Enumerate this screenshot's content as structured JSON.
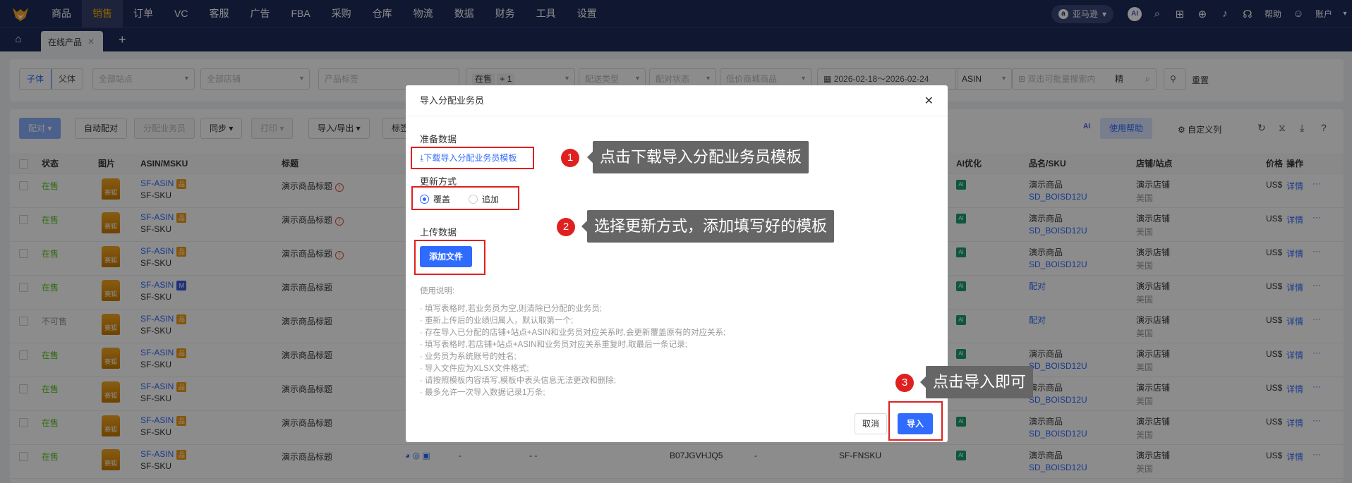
{
  "nav": {
    "items": [
      "商品",
      "销售",
      "订单",
      "VC",
      "客服",
      "广告",
      "FBA",
      "采购",
      "仓库",
      "物流",
      "数据",
      "财务",
      "工具",
      "设置"
    ],
    "active_index": 1,
    "marketplace": "亚马逊",
    "ai_badge": "AI",
    "help": "帮助",
    "account": "账户"
  },
  "tabs": {
    "active": "在线产品"
  },
  "filters": {
    "seg_child": "子体",
    "seg_parent": "父体",
    "site": "全部站点",
    "store": "全部店铺",
    "tag": "产品标签",
    "status_tag": "在售",
    "status_more": "+ 1",
    "ship_type": "配送类型",
    "pair_state": "配对状态",
    "low_price": "低价商城商品",
    "date_range": "2026-02-18～2026-02-24",
    "search_type": "ASIN",
    "search_placeholder": "双击可批量搜索内",
    "precise": "精",
    "reset": "重置"
  },
  "toolbar": {
    "pair": "配对",
    "auto_pair": "自动配对",
    "assign": "分配业务员",
    "sync": "同步",
    "print": "打印",
    "import_export": "导入/导出",
    "tag": "标签",
    "help": "使用帮助",
    "custom_cols": "自定义列"
  },
  "table": {
    "headers": {
      "status": "状态",
      "image": "图片",
      "asin": "ASIN/MSKU",
      "title": "标题",
      "ai": "AI优化",
      "sku": "品名/SKU",
      "store": "店铺/站点",
      "price": "价格",
      "ops": "操作"
    },
    "rows": [
      {
        "status": "在售",
        "asin": "SF-ASIN",
        "msku": "SF-SKU",
        "badge": "品",
        "title": "演示商品标题",
        "warn": true,
        "name": "演示商品",
        "sku": "SD_BOISD12U",
        "store": "演示店铺",
        "site": "美国",
        "price": "US$",
        "detail": "详情"
      },
      {
        "status": "在售",
        "asin": "SF-ASIN",
        "msku": "SF-SKU",
        "badge": "品",
        "title": "演示商品标题",
        "warn": true,
        "name": "演示商品",
        "sku": "SD_BOISD12U",
        "store": "演示店铺",
        "site": "美国",
        "price": "US$",
        "detail": "详情"
      },
      {
        "status": "在售",
        "asin": "SF-ASIN",
        "msku": "SF-SKU",
        "badge": "品",
        "title": "演示商品标题",
        "warn": true,
        "name": "演示商品",
        "sku": "SD_BOISD12U",
        "store": "演示店铺",
        "site": "美国",
        "price": "US$",
        "detail": "详情"
      },
      {
        "status": "在售",
        "asin": "SF-ASIN",
        "msku": "SF-SKU",
        "badge": "M",
        "title": "演示商品标题",
        "warn": false,
        "name": "配对",
        "sku": "",
        "store": "演示店铺",
        "site": "美国",
        "price": "US$",
        "detail": "详情"
      },
      {
        "status": "不可售",
        "asin": "SF-ASIN",
        "msku": "SF-SKU",
        "badge": "品",
        "title": "演示商品标题",
        "warn": false,
        "name": "配对",
        "sku": "",
        "store": "演示店铺",
        "site": "美国",
        "price": "US$",
        "detail": "详情"
      },
      {
        "status": "在售",
        "asin": "SF-ASIN",
        "msku": "SF-SKU",
        "badge": "品",
        "title": "演示商品标题",
        "warn": false,
        "name": "演示商品",
        "sku": "SD_BOISD12U",
        "store": "演示店铺",
        "site": "美国",
        "price": "US$",
        "detail": "详情"
      },
      {
        "status": "在售",
        "asin": "SF-ASIN",
        "msku": "SF-SKU",
        "badge": "品",
        "title": "演示商品标题",
        "warn": false,
        "name": "演示商品",
        "sku": "SD_BOISD12U",
        "store": "演示店铺",
        "site": "美国",
        "price": "US$",
        "detail": "详情"
      },
      {
        "status": "在售",
        "asin": "SF-ASIN",
        "msku": "SF-SKU",
        "badge": "品",
        "title": "演示商品标题",
        "warn": false,
        "name": "演示商品",
        "sku": "SD_BOISD12U",
        "store": "演示店铺",
        "site": "美国",
        "price": "US$",
        "detail": "详情"
      },
      {
        "status": "在售",
        "asin": "SF-ASIN",
        "msku": "SF-SKU",
        "badge": "品",
        "title": "演示商品标题",
        "warn": false,
        "name": "演示商品",
        "sku": "SD_BOISD12U",
        "store": "演示店铺",
        "site": "美国",
        "price": "US$",
        "detail": "详情",
        "extra_dash1": "-",
        "extra_dash2": "- -",
        "extra_asin": "B07JGVHJQ5",
        "extra_dash3": "-",
        "extra_fnsku": "SF-FNSKU"
      }
    ],
    "thumb_text": "赛狐"
  },
  "modal": {
    "title": "导入分配业务员",
    "prepare_label": "准备数据",
    "download_link": "下载导入分配业务员模板",
    "update_label": "更新方式",
    "radio_overwrite": "覆盖",
    "radio_append": "追加",
    "upload_label": "上传数据",
    "add_file": "添加文件",
    "notes_title": "使用说明:",
    "notes": [
      "· 填写表格时,若业务员为空,则清除已分配的业务员;",
      "· 重新上传后的业绩归属人，默认取第一个;",
      "· 存在导入已分配的店铺+站点+ASIN和业务员对应关系时,会更新覆盖原有的对应关系;",
      "· 填写表格时,若店铺+站点+ASIN和业务员对应关系重复时,取最后一条记录;",
      "· 业务员为系统账号的姓名;",
      "· 导入文件应为XLSX文件格式;",
      "· 请按照模板内容填写,模板中表头信息无法更改和删除;",
      "· 最多允许一次导入数据记录1万条;"
    ],
    "cancel": "取消",
    "import": "导入"
  },
  "callouts": [
    {
      "num": "1",
      "text": "点击下载导入分配业务员模板"
    },
    {
      "num": "2",
      "text": "选择更新方式，添加填写好的模板"
    },
    {
      "num": "3",
      "text": "点击导入即可"
    }
  ]
}
